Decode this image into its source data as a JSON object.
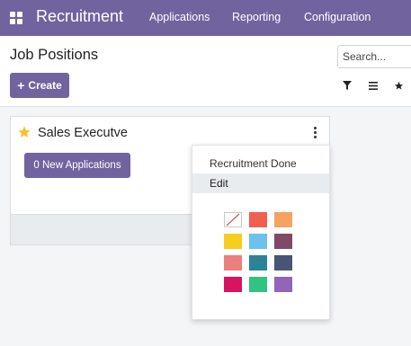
{
  "navbar": {
    "brand": "Recruitment",
    "menu": [
      "Applications",
      "Reporting",
      "Configuration"
    ],
    "icon": "apps-grid-icon",
    "color": "#71639e"
  },
  "control_panel": {
    "title": "Job Positions",
    "create_label": "Create",
    "search_placeholder": "Search...",
    "icons": [
      "filter-icon",
      "group-by-icon",
      "favorite-icon"
    ]
  },
  "card": {
    "title": "Sales Executve",
    "favorite": true,
    "new_applications_label": "0 New Applications"
  },
  "dropdown": {
    "items": [
      "Recruitment Done",
      "Edit"
    ],
    "highlighted": "Edit",
    "colors": [
      "none",
      "#f06050",
      "#f4a460",
      "#f7cd1f",
      "#6cc1ed",
      "#814968",
      "#eb7e7f",
      "#2c8397",
      "#475577",
      "#d6145f",
      "#30c381",
      "#9365b8"
    ]
  }
}
